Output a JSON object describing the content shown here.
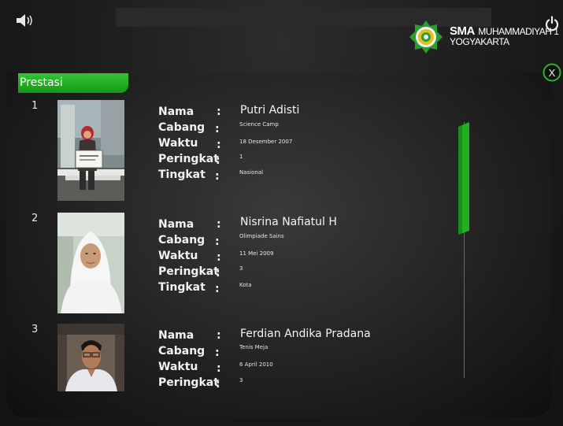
{
  "header": {
    "school_name_bold": "SMA",
    "school_name_rest": "MUHAMMADIYAH 1",
    "school_city": "YOGYAKARTA"
  },
  "section": {
    "tab_label": "Prestasi"
  },
  "field_labels": {
    "nama": "Nama",
    "cabang": "Cabang",
    "waktu": "Waktu",
    "peringkat": "Peringkat",
    "tingkat": "Tingkat",
    "colon": ":"
  },
  "entries": [
    {
      "number": "1",
      "nama": "Putri Adisti",
      "cabang": "Science Camp",
      "waktu": "18 Desember 2007",
      "peringkat": "1",
      "tingkat": "Nasional"
    },
    {
      "number": "2",
      "nama": "Nisrina Nafiatul H",
      "cabang": "Olimpiade Sains",
      "waktu": "11 Mei 2009",
      "peringkat": "3",
      "tingkat": "Kota"
    },
    {
      "number": "3",
      "nama": "Ferdian Andika Pradana",
      "cabang": "Tenis Meja",
      "waktu": "6 April 2010",
      "peringkat": "3"
    }
  ],
  "buttons": {
    "close_label": "X"
  },
  "icons": {
    "sound": "speaker-icon",
    "power": "power-icon",
    "close": "close-icon",
    "logo": "school-emblem-icon"
  },
  "colors": {
    "accent": "#1fb51f",
    "background": "#1c1c1c"
  },
  "scroll": {
    "thumb_position_fraction": 0.0
  }
}
